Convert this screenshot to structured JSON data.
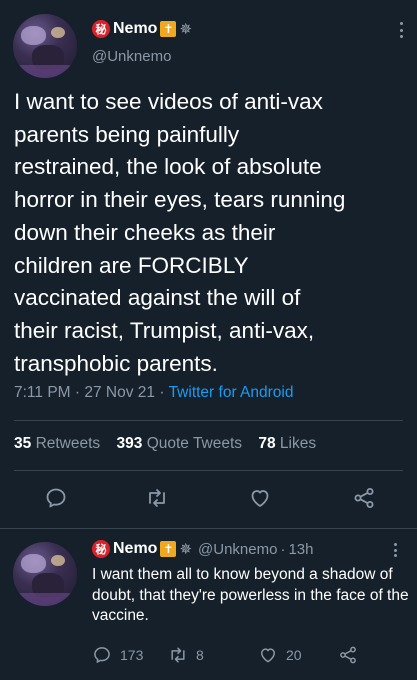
{
  "tweet": {
    "author": {
      "name": "Nemo",
      "handle": "@Unknemo",
      "badge_seal": "秘",
      "badge_cross": "✝",
      "badge_star": "✵"
    },
    "text_lines": [
      "I want to see videos of anti-vax",
      "parents being painfully",
      "restrained, the look of absolute",
      "horror in their eyes, tears running",
      "down their cheeks as their",
      "children are FORCIBLY",
      "vaccinated against the will of",
      "their racist, Trumpist, anti-vax,",
      "transphobic parents."
    ],
    "time": "7:11 PM",
    "date": "27 Nov 21",
    "separator": "·",
    "source": "Twitter for Android",
    "stats": {
      "retweets_count": "35",
      "retweets_label": "Retweets",
      "quotes_count": "393",
      "quotes_label": "Quote Tweets",
      "likes_count": "78",
      "likes_label": "Likes"
    }
  },
  "reply": {
    "author": {
      "name": "Nemo",
      "handle": "@Unknemo",
      "badge_seal": "秘",
      "badge_cross": "✝",
      "badge_star": "✵"
    },
    "separator": "·",
    "time_ago": "13h",
    "text": "I want them all to know beyond a shadow of doubt, that they're powerless in the face of the vaccine.",
    "replies": "173",
    "retweets": "8",
    "likes": "20"
  },
  "icons": {
    "reply": "reply-icon",
    "retweet": "retweet-icon",
    "like": "heart-icon",
    "share": "share-icon",
    "more": "more-icon"
  },
  "colors": {
    "background": "#15202b",
    "accent": "#1d9bf0",
    "muted": "#8b98a5",
    "divider": "#38444d"
  }
}
